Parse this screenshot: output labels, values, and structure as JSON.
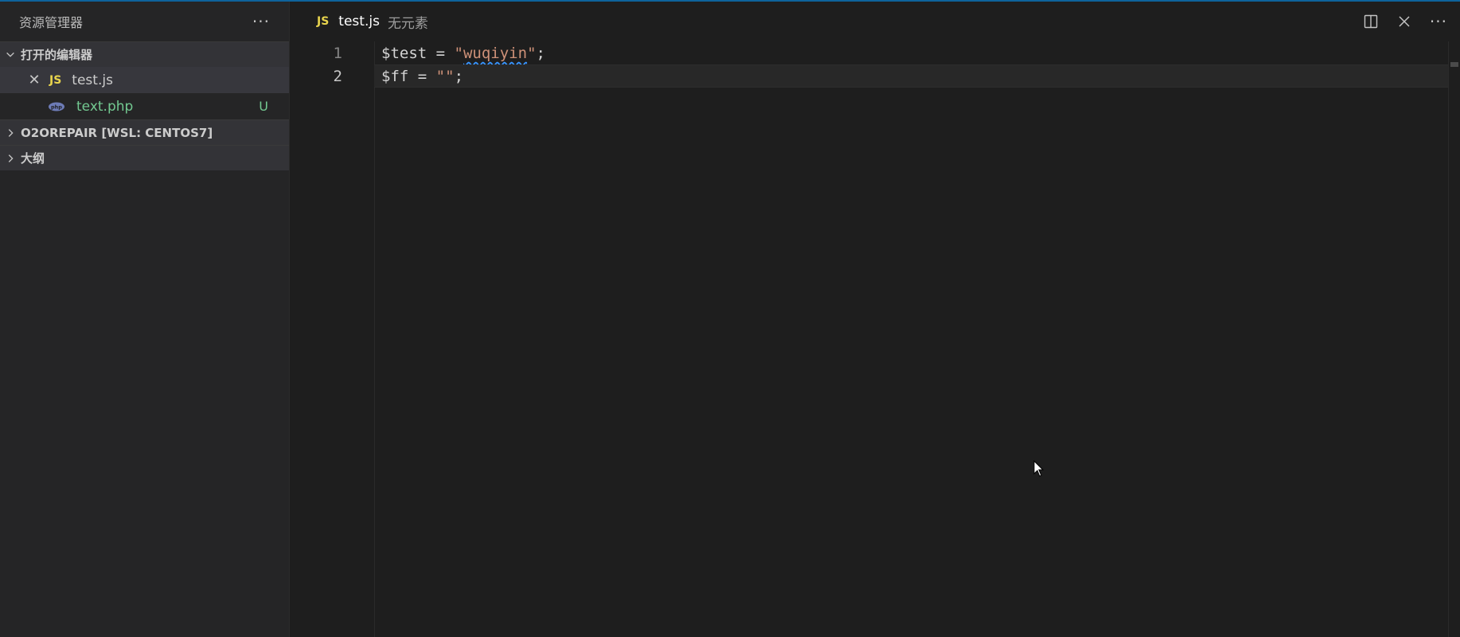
{
  "sidebar": {
    "title": "资源管理器",
    "more": "···",
    "open_editors": {
      "label": "打开的编辑器",
      "items": [
        {
          "close": "✕",
          "icon_label": "JS",
          "name": "test.js",
          "active": true
        },
        {
          "icon": "php-elephant-icon",
          "name": "text.php",
          "status": "U"
        }
      ]
    },
    "sections": [
      {
        "label": "O2OREPAIR [WSL: CENTOS7]"
      },
      {
        "label": "大纲"
      }
    ]
  },
  "tab": {
    "icon_label": "JS",
    "name": "test.js",
    "description": "无元素"
  },
  "tab_actions": {
    "more": "···"
  },
  "editor": {
    "lines": [
      {
        "number": "1",
        "var": "$test",
        "op": " = ",
        "str_open": "\"",
        "str": "wuqiyin",
        "str_close": "\"",
        "end": ";"
      },
      {
        "number": "2",
        "var": "$ff",
        "op": " = ",
        "str_open": "\"",
        "str": "",
        "str_close": "\"",
        "end": ";"
      }
    ]
  },
  "colors": {
    "accent": "#0e639c",
    "js": "#e8d44d",
    "untracked": "#73c991",
    "string": "#ce9178"
  }
}
